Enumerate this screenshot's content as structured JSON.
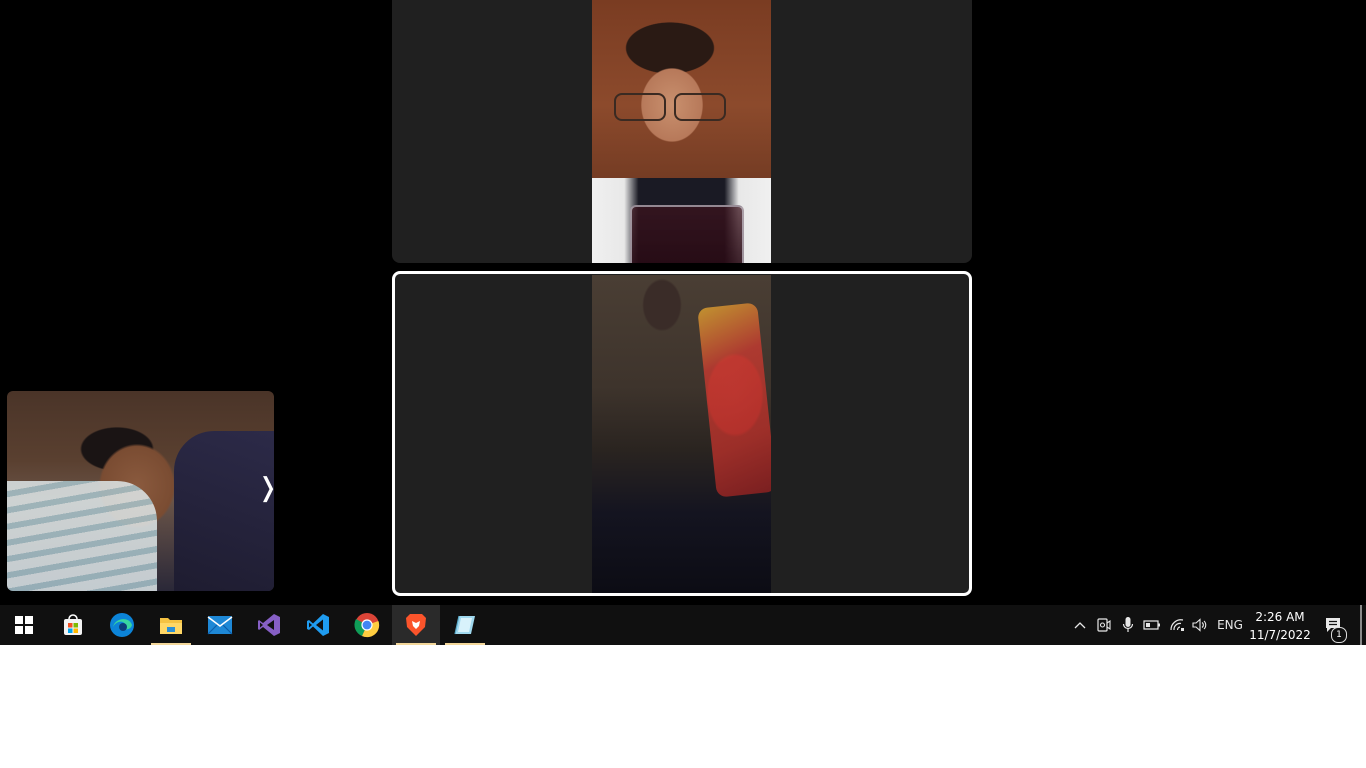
{
  "call": {
    "participants": [
      {
        "name": "participant-video-top",
        "focused": false
      },
      {
        "name": "participant-video-bottom",
        "focused": true
      }
    ],
    "self_view_chevron": "❭"
  },
  "taskbar": {
    "apps": [
      {
        "name": "start-button",
        "icon": "windows-logo-icon",
        "active": false
      },
      {
        "name": "microsoft-store",
        "icon": "store-icon",
        "active": false
      },
      {
        "name": "microsoft-edge",
        "icon": "edge-icon",
        "active": false
      },
      {
        "name": "file-explorer",
        "icon": "folder-icon",
        "active": true
      },
      {
        "name": "mail",
        "icon": "mail-icon",
        "active": false
      },
      {
        "name": "visual-studio",
        "icon": "visual-studio-icon",
        "active": false
      },
      {
        "name": "vs-code",
        "icon": "vscode-icon",
        "active": false
      },
      {
        "name": "google-chrome",
        "icon": "chrome-icon",
        "active": false
      },
      {
        "name": "brave-browser",
        "icon": "brave-icon",
        "active": true
      },
      {
        "name": "unknown-app",
        "icon": "glass-app-icon",
        "active": true
      }
    ],
    "tray": {
      "language": "ENG",
      "time": "2:26 AM",
      "date": "11/7/2022",
      "notification_count": "1"
    }
  },
  "colors": {
    "taskbar_bg": "#101010",
    "active_indicator": "#f3d79a",
    "focus_border": "#ffffff"
  }
}
